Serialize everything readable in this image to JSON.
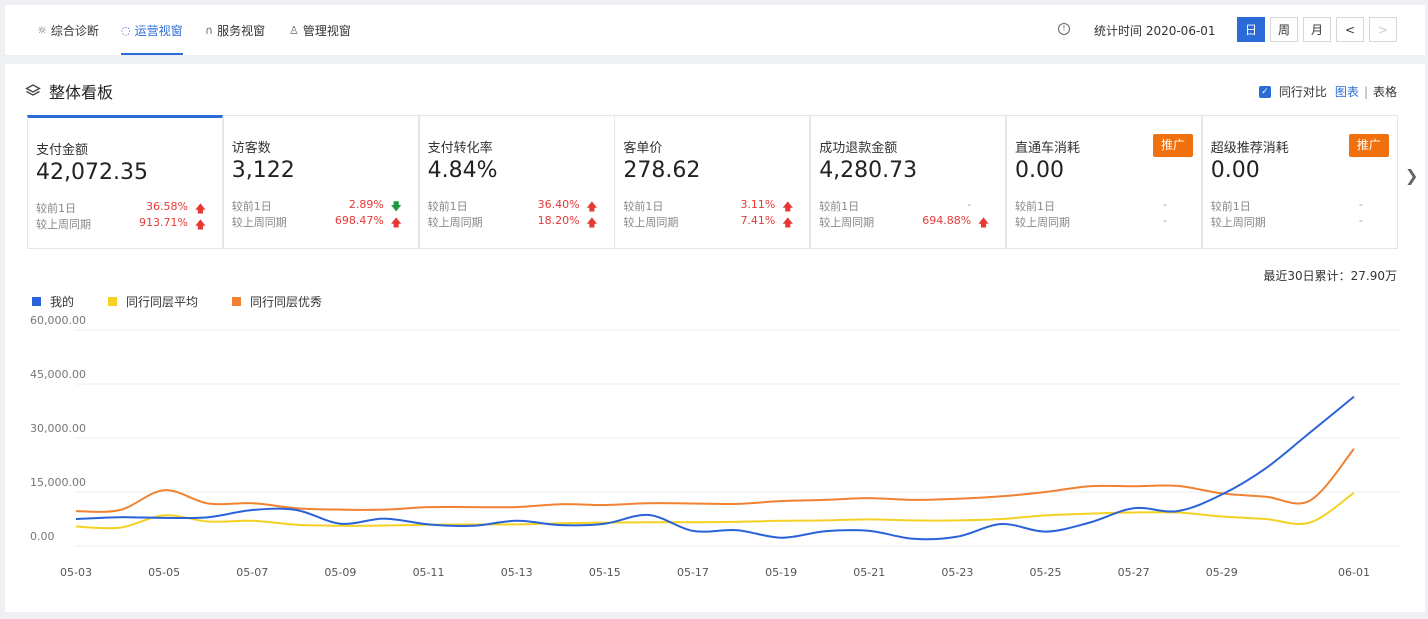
{
  "nav": {
    "tabs": [
      {
        "icon": "bulb-icon",
        "label": "综合诊断"
      },
      {
        "icon": "shield-icon",
        "label": "运营视窗"
      },
      {
        "icon": "headset-icon",
        "label": "服务视窗"
      },
      {
        "icon": "user-icon",
        "label": "管理视窗"
      }
    ],
    "active_tab": 1,
    "stat_time": "统计时间 2020-06-01",
    "periods": [
      "日",
      "周",
      "月"
    ],
    "active_period": 0,
    "prev": "<",
    "next": ">"
  },
  "panel": {
    "title": "整体看板",
    "compare_label": "同行对比",
    "view_chart": "图表",
    "view_table": "表格"
  },
  "cards": [
    {
      "name": "支付金额",
      "value": "42,072.35",
      "rows": [
        {
          "label": "较前1日",
          "pct": "36.58%",
          "dir": "up"
        },
        {
          "label": "较上周同期",
          "pct": "913.71%",
          "dir": "up"
        }
      ]
    },
    {
      "name": "访客数",
      "value": "3,122",
      "rows": [
        {
          "label": "较前1日",
          "pct": "2.89%",
          "dir": "down"
        },
        {
          "label": "较上周同期",
          "pct": "698.47%",
          "dir": "up"
        }
      ]
    },
    {
      "name": "支付转化率",
      "value": "4.84%",
      "rows": [
        {
          "label": "较前1日",
          "pct": "36.40%",
          "dir": "up"
        },
        {
          "label": "较上周同期",
          "pct": "18.20%",
          "dir": "up"
        }
      ]
    },
    {
      "name": "客单价",
      "value": "278.62",
      "rows": [
        {
          "label": "较前1日",
          "pct": "3.11%",
          "dir": "up"
        },
        {
          "label": "较上周同期",
          "pct": "7.41%",
          "dir": "up"
        }
      ]
    },
    {
      "name": "成功退款金额",
      "value": "4,280.73",
      "rows": [
        {
          "label": "较前1日",
          "pct": "-",
          "dir": ""
        },
        {
          "label": "较上周同期",
          "pct": "694.88%",
          "dir": "up"
        }
      ]
    },
    {
      "name": "直通车消耗",
      "value": "0.00",
      "promo": "推广",
      "rows": [
        {
          "label": "较前1日",
          "pct": "-",
          "dir": ""
        },
        {
          "label": "较上周同期",
          "pct": "-",
          "dir": ""
        }
      ]
    },
    {
      "name": "超级推荐消耗",
      "value": "0.00",
      "promo": "推广",
      "rows": [
        {
          "label": "较前1日",
          "pct": "-",
          "dir": ""
        },
        {
          "label": "较上周同期",
          "pct": "-",
          "dir": ""
        }
      ]
    }
  ],
  "cumulative": "最近30日累计：27.90万",
  "chart_data": {
    "type": "line",
    "x": [
      "05-03",
      "05-04",
      "05-05",
      "05-06",
      "05-07",
      "05-08",
      "05-09",
      "05-10",
      "05-11",
      "05-12",
      "05-13",
      "05-14",
      "05-15",
      "05-16",
      "05-17",
      "05-18",
      "05-19",
      "05-20",
      "05-21",
      "05-22",
      "05-23",
      "05-24",
      "05-25",
      "05-26",
      "05-27",
      "05-28",
      "05-29",
      "05-30",
      "05-31",
      "06-01"
    ],
    "x_tick_labels": [
      "05-03",
      "05-05",
      "05-07",
      "05-09",
      "05-11",
      "05-13",
      "05-15",
      "05-17",
      "05-19",
      "05-21",
      "05-23",
      "05-25",
      "05-27",
      "05-29",
      "06-01"
    ],
    "y_ticks": [
      0,
      15000,
      30000,
      45000,
      60000
    ],
    "y_tick_labels": [
      "0.00",
      "15,000.00",
      "30,000.00",
      "45,000.00",
      "60,000.00"
    ],
    "ylim": [
      0,
      60000
    ],
    "series": [
      {
        "name": "我的",
        "color": "#2a62d8",
        "values": [
          7500,
          8000,
          7800,
          8000,
          10000,
          10000,
          6200,
          7600,
          6000,
          5600,
          7000,
          5800,
          6200,
          8600,
          4200,
          4400,
          2300,
          4100,
          4200,
          2000,
          2600,
          6100,
          4000,
          6500,
          10500,
          9700,
          14300,
          21600,
          31500,
          41500
        ]
      },
      {
        "name": "同行同层平均",
        "color": "#f5d124",
        "values": [
          5400,
          5100,
          8500,
          6800,
          7000,
          5900,
          5600,
          5700,
          5900,
          6000,
          6000,
          6300,
          6500,
          6600,
          6600,
          6700,
          7000,
          7100,
          7400,
          7100,
          7100,
          7500,
          8500,
          9000,
          9300,
          9300,
          8200,
          7500,
          6500,
          14800
        ]
      },
      {
        "name": "同行同层优秀",
        "color": "#f08232",
        "values": [
          9700,
          10000,
          15500,
          11800,
          11900,
          10500,
          10100,
          10100,
          10800,
          10800,
          10800,
          11600,
          11400,
          11900,
          11800,
          11700,
          12500,
          12800,
          13300,
          12800,
          13100,
          13800,
          15000,
          16600,
          16600,
          16700,
          14600,
          13700,
          12600,
          27000
        ]
      }
    ]
  }
}
